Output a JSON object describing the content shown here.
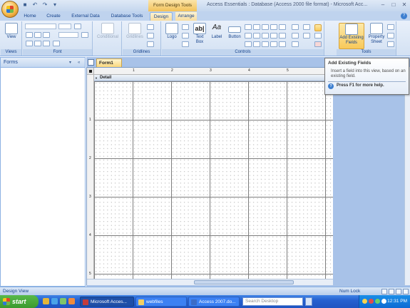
{
  "window": {
    "title": "Access Essentials : Database (Access 2000 file format) - Microsoft Acc...",
    "contextual_group": "Form Design Tools",
    "quick_access": [
      "save-icon",
      "undo-icon",
      "redo-icon",
      "customize-icon"
    ],
    "controls": [
      "minimize-icon",
      "maximize-icon",
      "close-icon"
    ]
  },
  "tabs": [
    {
      "label": "Home",
      "active": false
    },
    {
      "label": "Create",
      "active": false
    },
    {
      "label": "External Data",
      "active": false
    },
    {
      "label": "Database Tools",
      "active": false
    },
    {
      "label": "Design",
      "active": true
    },
    {
      "label": "Arrange",
      "active": false
    }
  ],
  "ribbon": {
    "groups": {
      "views": {
        "label": "Views",
        "view_button": "View"
      },
      "font": {
        "label": "Font"
      },
      "conditional": {
        "label": "Conditional"
      },
      "gridlines": {
        "label": "Gridlines",
        "button": "Gridlines"
      },
      "controls": {
        "label": "Controls",
        "logo": "Logo",
        "text_box": "Text Box",
        "label_btn": "Label",
        "button": "Button"
      },
      "tools": {
        "label": "Tools",
        "add_existing_fields": "Add Existing Fields",
        "property_sheet": "Property Sheet"
      }
    }
  },
  "nav_pane": {
    "title": "Forms"
  },
  "document": {
    "tab_label": "Form1",
    "section": "Detail",
    "ruler_h_numbers": [
      "1",
      "2",
      "3",
      "4",
      "5"
    ],
    "ruler_v_numbers": [
      "1",
      "2",
      "3",
      "4",
      "5"
    ]
  },
  "tooltip": {
    "title": "Add Existing Fields",
    "body": "Insert a field into this view, based on an existing field.",
    "help": "Press F1 for more help."
  },
  "status_bar": {
    "left": "Design View",
    "right": "Num Lock"
  },
  "taskbar": {
    "start": "start",
    "buttons": [
      {
        "label": "Microsoft Acces...",
        "active": true
      },
      {
        "label": "webfiles",
        "active": false
      },
      {
        "label": "Access 2007.do...",
        "active": false
      }
    ],
    "search_placeholder": "Search Desktop",
    "clock": "12:31 PM"
  },
  "colors": {
    "ribbon_bg": "#d3e1f3",
    "accent": "#15428b",
    "highlight": "#f8c95a",
    "taskbar": "#2560d0",
    "start": "#3a9a2e"
  }
}
